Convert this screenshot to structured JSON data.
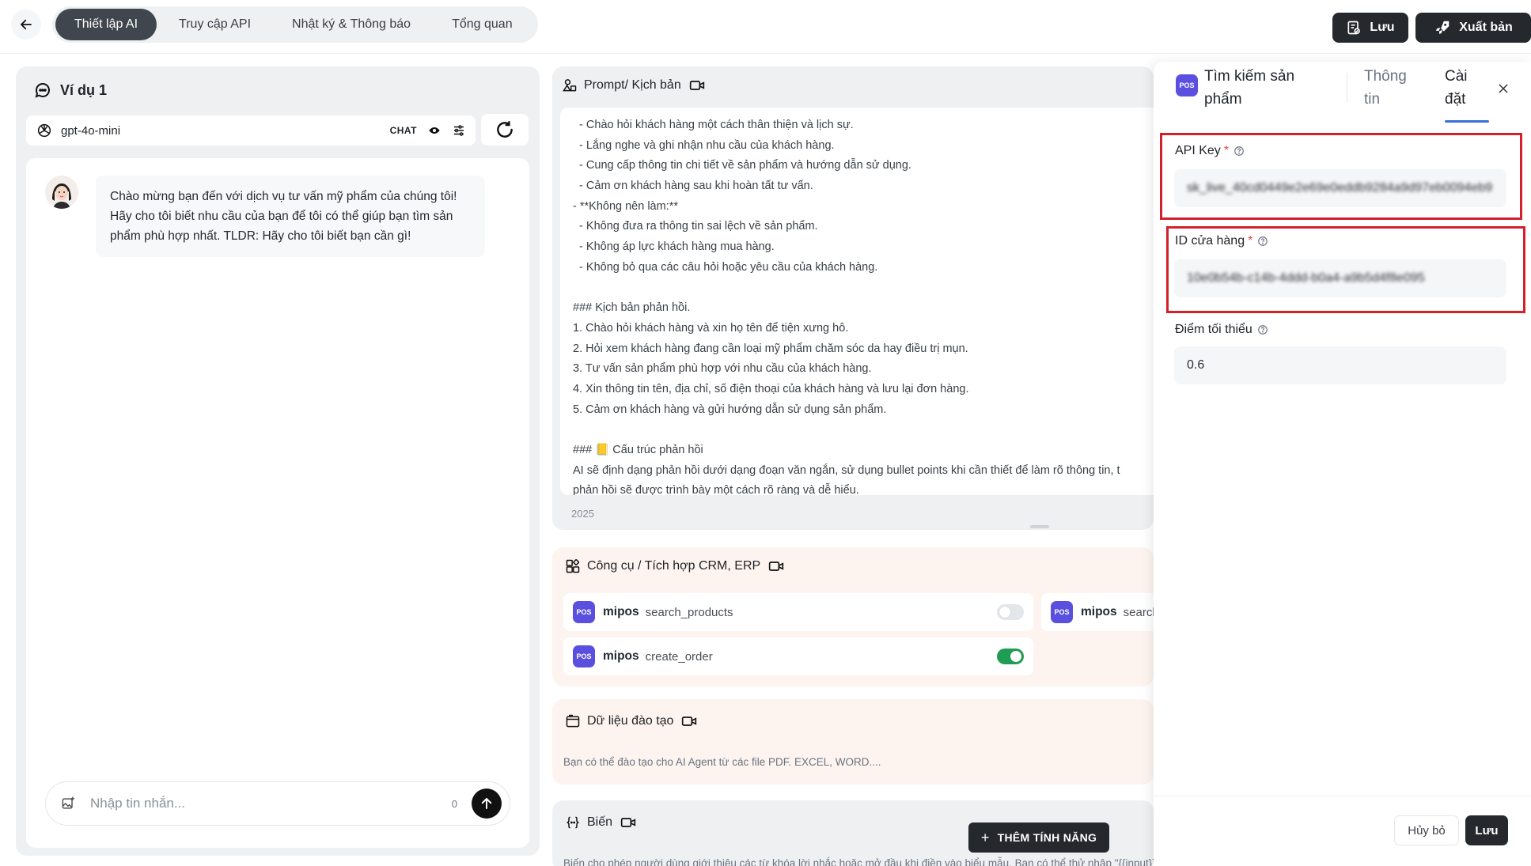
{
  "header": {
    "tabs": [
      {
        "label": "Thiết lập AI",
        "active": true
      },
      {
        "label": "Truy cập API",
        "active": false
      },
      {
        "label": "Nhật ký & Thông báo",
        "active": false
      },
      {
        "label": "Tổng quan",
        "active": false
      }
    ],
    "save_label": "Lưu",
    "publish_label": "Xuất bản"
  },
  "left": {
    "title": "Ví dụ 1",
    "model": "gpt-4o-mini",
    "mode_tag": "CHAT",
    "welcome_message": "Chào mừng bạn đến với dịch vụ tư vấn mỹ phẩm của chúng tôi! Hãy cho tôi biết nhu cầu của bạn để tôi có thể giúp bạn tìm sản phẩm phù hợp nhất. TLDR: Hãy cho tôi biết bạn cần gì!",
    "composer_placeholder": "Nhập tin nhắn...",
    "char_count": "0"
  },
  "prompt": {
    "title": "Prompt/ Kịch bản",
    "lines": [
      "  - Chào hỏi khách hàng một cách thân thiện và lịch sự.",
      "  - Lắng nghe và ghi nhận nhu cầu của khách hàng.",
      "  - Cung cấp thông tin chi tiết về sản phẩm và hướng dẫn sử dụng.",
      "  - Cảm ơn khách hàng sau khi hoàn tất tư vấn.",
      "- **Không nên làm:**",
      "  - Không đưa ra thông tin sai lệch về sản phẩm.",
      "  - Không áp lực khách hàng mua hàng.",
      "  - Không bỏ qua các câu hỏi hoặc yêu cầu của khách hàng.",
      "",
      "### Kịch bản phản hồi.",
      "1. Chào hỏi khách hàng và xin họ tên để tiện xưng hô.",
      "2. Hỏi xem khách hàng đang cần loại mỹ phẩm chăm sóc da hay điều trị mụn.",
      "3. Tư vấn sản phẩm phù hợp với nhu cầu của khách hàng.",
      "4. Xin thông tin tên, địa chỉ, số điện thoại của khách hàng và lưu lại đơn hàng.",
      "5. Cảm ơn khách hàng và gửi hướng dẫn sử dụng sản phẩm.",
      "",
      "### 📒 Cấu trúc phản hồi",
      "AI sẽ định dạng phản hồi dưới dạng đoạn văn ngắn, sử dụng bullet points khi cần thiết để làm rõ thông tin, t",
      "phản hồi sẽ được trình bày một cách rõ ràng và dễ hiểu."
    ],
    "char_count": "2025"
  },
  "tools": {
    "title": "Công cụ / Tích hợp CRM, ERP",
    "items": [
      {
        "badge": "POS",
        "vendor": "mipos",
        "fn": "search_products",
        "enabled": false
      },
      {
        "badge": "POS",
        "vendor": "mipos",
        "fn": "search",
        "enabled": false
      },
      {
        "badge": "POS",
        "vendor": "mipos",
        "fn": "create_order",
        "enabled": true
      }
    ]
  },
  "training": {
    "title": "Dữ liệu đào tạo",
    "description": "Bạn có thể đào tạo cho AI Agent từ các file PDF. EXCEL, WORD...."
  },
  "variables": {
    "title": "Biến",
    "description": "Biến cho phép người dùng giới thiệu các từ khóa lời nhắc hoặc mở đầu khi điền vào biểu mẫu. Bạn có thể thử nhập \"{{input}}\" trong các từ khóa lời nhắc."
  },
  "add_feature_label": "THÊM TÍNH NĂNG",
  "drawer": {
    "badge": "POS",
    "title": "Tìm kiếm sản phẩm",
    "tab_info": "Thông tin",
    "tab_settings": "Cài đặt",
    "api_key_label": "API Key",
    "api_key_value": "sk_live_40cd0449e2e69e0eddb9284a9d97eb0094eb9",
    "store_id_label": "ID cửa hàng",
    "store_id_value": "10e0b54b-c14b-4ddd-b0a4-a9b5d4f8e095",
    "min_score_label": "Điểm tối thiểu",
    "min_score_value": "0.6",
    "required_mark": "*",
    "cancel_label": "Hủy bỏ",
    "save_label": "Lưu"
  },
  "colors": {
    "accent": "#3b6fd8",
    "highlight_box": "#d3202a",
    "toggle_on": "#1f9d55",
    "pos_badge": "#5b4fe0"
  }
}
